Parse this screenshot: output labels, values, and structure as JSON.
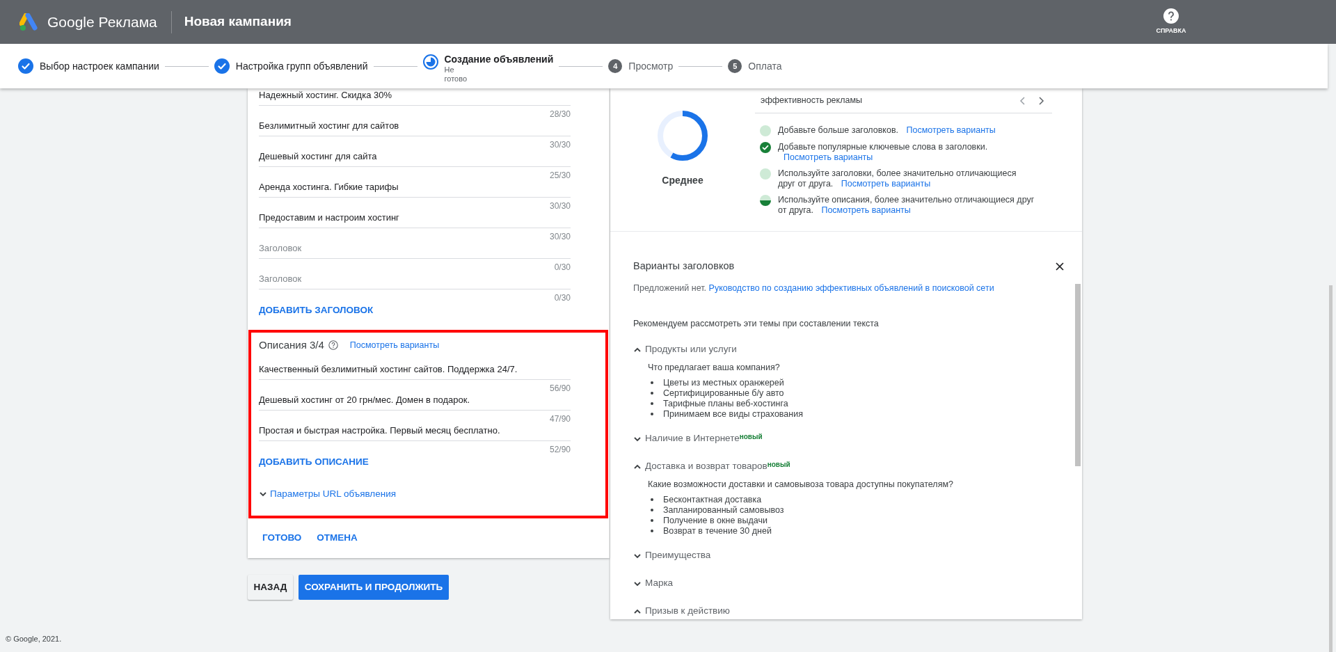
{
  "header": {
    "product": "Google Реклама",
    "title": "Новая кампания",
    "help_label": "СПРАВКА"
  },
  "steps": [
    {
      "label": "Выбор настроек кампании",
      "kind": "done"
    },
    {
      "label": "Настройка групп объявлений",
      "kind": "done"
    },
    {
      "label": "Создание объявлений",
      "kind": "current",
      "status": "Не готово"
    },
    {
      "label": "Просмотр",
      "kind": "todo",
      "number": "4"
    },
    {
      "label": "Оплата",
      "kind": "todo",
      "number": "5"
    }
  ],
  "headlines": [
    {
      "value": "Надежный хостинг. Скидка 30%",
      "counter": "28/30"
    },
    {
      "value": "Безлимитный хостинг для сайтов",
      "counter": "30/30"
    },
    {
      "value": "Дешевый хостинг для сайта",
      "counter": "25/30"
    },
    {
      "value": "Аренда хостинга. Гибкие тарифы",
      "counter": "30/30"
    },
    {
      "value": "Предоставим и настроим хостинг",
      "counter": "30/30"
    },
    {
      "placeholder": "Заголовок",
      "counter": "0/30"
    },
    {
      "placeholder": "Заголовок",
      "counter": "0/30"
    }
  ],
  "add_headline": "ДОБАВИТЬ ЗАГОЛОВОК",
  "descriptions": {
    "title": "Описания 3/4",
    "link": "Посмотреть варианты",
    "highlighted": true,
    "items": [
      {
        "value": "Качественный безлимитный хостинг сайтов. Поддержка 24/7.",
        "counter": "56/90"
      },
      {
        "value": "Дешевый хостинг от 20 грн/мес. Домен в подарок.",
        "counter": "47/90"
      },
      {
        "value": "Простая и быстрая настройка. Первый месяц бесплатно.",
        "counter": "52/90"
      }
    ],
    "add": "ДОБАВИТЬ ОПИСАНИЕ",
    "url_params": "Параметры URL объявления"
  },
  "card_actions": [
    "ГОТОВО",
    "ОТМЕНА"
  ],
  "nav_buttons": [
    {
      "label": "НАЗАД",
      "kind": "secondary"
    },
    {
      "label": "СОХРАНИТЬ И ПРОДОЛЖИТЬ",
      "kind": "primary"
    }
  ],
  "footer": "© Google, 2021.",
  "ad_strength": {
    "rating": "Среднее",
    "level": 0.58,
    "caption": "эффективность рекламы",
    "tips": [
      {
        "text": "Добавьте больше заголовков.",
        "link": "Посмотреть варианты",
        "kind": "todo"
      },
      {
        "text": "Добавьте популярные ключевые слова в заголовки.",
        "link": "Посмотреть варианты",
        "kind": "done"
      },
      {
        "text": "Используйте заголовки, более значительно отличающиеся друг от друга.",
        "link": "Посмотреть варианты",
        "kind": "todo"
      },
      {
        "text": "Используйте описания, более значительно отличающиеся друг от друга.",
        "link": "Посмотреть варианты",
        "kind": "partial"
      }
    ]
  },
  "suggestions": {
    "title": "Варианты заголовков",
    "note": "Предложений нет.",
    "guide_link": "Руководство по созданию эффективных объявлений в поисковой сети",
    "intro": "Рекомендуем рассмотреть эти темы при составлении текста",
    "topics": [
      {
        "title": "Продукты или услуги",
        "expanded": true,
        "question": "Что предлагает ваша компания?",
        "examples": [
          "Цветы из местных оранжерей",
          "Сертифицированные б/у авто",
          "Тарифные планы веб-хостинга",
          "Принимаем все виды страхования"
        ]
      },
      {
        "title": "Наличие в Интернете",
        "badge": "новый",
        "expanded": false
      },
      {
        "title": "Доставка и возврат товаров",
        "badge": "новый",
        "expanded": true,
        "question": "Какие возможности доставки и самовывоза товара доступны покупателям?",
        "examples": [
          "Бесконтактная доставка",
          "Запланированный самовывоз",
          "Получение в окне выдачи",
          "Возврат в течение 30 дней"
        ]
      },
      {
        "title": "Преимущества",
        "expanded": false
      },
      {
        "title": "Марка",
        "expanded": false
      },
      {
        "title": "Призыв к действию",
        "expanded": true
      }
    ]
  }
}
